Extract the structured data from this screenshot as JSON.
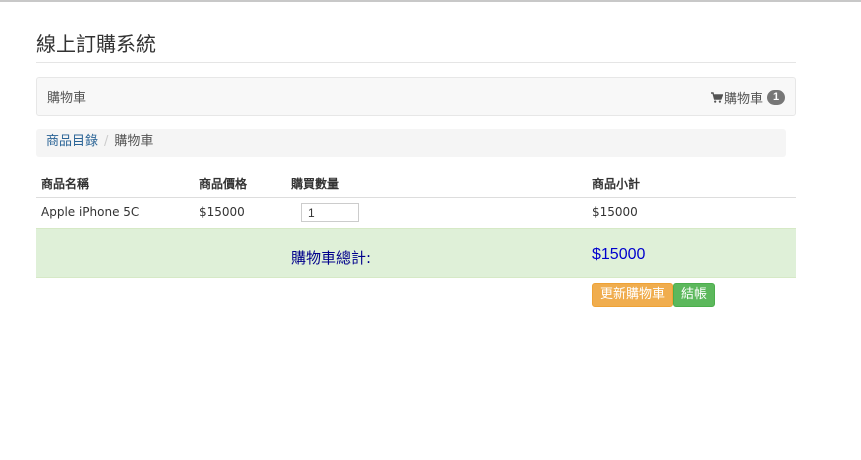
{
  "page": {
    "title": "線上訂購系統"
  },
  "navbar": {
    "brand": "購物車",
    "cart_link": "購物車",
    "cart_count": "1",
    "cart_icon": "shopping-cart-icon"
  },
  "breadcrumb": {
    "items": [
      {
        "label": "商品目錄"
      },
      {
        "label": "購物車"
      }
    ]
  },
  "table": {
    "headers": [
      "商品名稱",
      "商品價格",
      "購買數量",
      "商品小計"
    ],
    "rows": [
      {
        "name": "Apple iPhone 5C",
        "price": "$15000",
        "quantity": "1",
        "subtotal": "$15000"
      }
    ],
    "total_label": "購物車總計:",
    "total_value": "$15000"
  },
  "actions": {
    "update_label": "更新購物車",
    "checkout_label": "結帳"
  },
  "colors": {
    "update_button": "#f0ad4e",
    "checkout_button": "#5cb85c",
    "total_row_bg": "#dff0d8",
    "link": "#2a6496"
  }
}
